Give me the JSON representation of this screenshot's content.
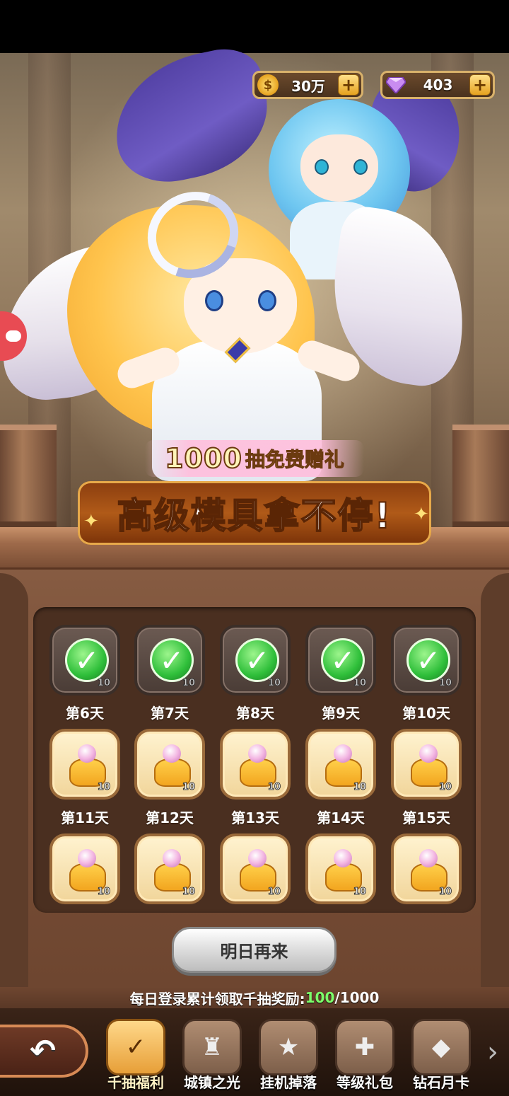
{
  "currency": {
    "coins": "30万",
    "diamonds": "403",
    "plus_label": "+"
  },
  "banner": {
    "count": "1000",
    "subtitle": "抽免费赠礼",
    "headline": "高级模具拿不停!"
  },
  "rewards": {
    "row1": [
      {
        "day": "第6天",
        "count": "10",
        "claimed": true
      },
      {
        "day": "第7天",
        "count": "10",
        "claimed": true
      },
      {
        "day": "第8天",
        "count": "10",
        "claimed": true
      },
      {
        "day": "第9天",
        "count": "10",
        "claimed": true
      },
      {
        "day": "第10天",
        "count": "10",
        "claimed": true
      }
    ],
    "row2": [
      {
        "day": "第11天",
        "count": "10",
        "claimed": false
      },
      {
        "day": "第12天",
        "count": "10",
        "claimed": false
      },
      {
        "day": "第13天",
        "count": "10",
        "claimed": false
      },
      {
        "day": "第14天",
        "count": "10",
        "claimed": false
      },
      {
        "day": "第15天",
        "count": "10",
        "claimed": false
      }
    ],
    "row3": [
      {
        "count": "10",
        "claimed": false
      },
      {
        "count": "10",
        "claimed": false
      },
      {
        "count": "10",
        "claimed": false
      },
      {
        "count": "10",
        "claimed": false
      },
      {
        "count": "10",
        "claimed": false
      }
    ]
  },
  "action_button": "明日再来",
  "progress": {
    "label": "每日登录累计领取千抽奖励:",
    "current": "100",
    "total": "/1000"
  },
  "nav": {
    "items": [
      {
        "label": "千抽福利",
        "icon": "book-check-icon",
        "active": true
      },
      {
        "label": "城镇之光",
        "icon": "castle-icon",
        "active": false
      },
      {
        "label": "挂机掉落",
        "icon": "treasure-chest-icon",
        "active": false
      },
      {
        "label": "等级礼包",
        "icon": "gift-box-icon",
        "active": false
      },
      {
        "label": "钻石月卡",
        "icon": "diamond-card-icon",
        "active": false
      }
    ]
  },
  "colors": {
    "progress_current": "#7cff6a",
    "active_tab": "#e79f38"
  }
}
